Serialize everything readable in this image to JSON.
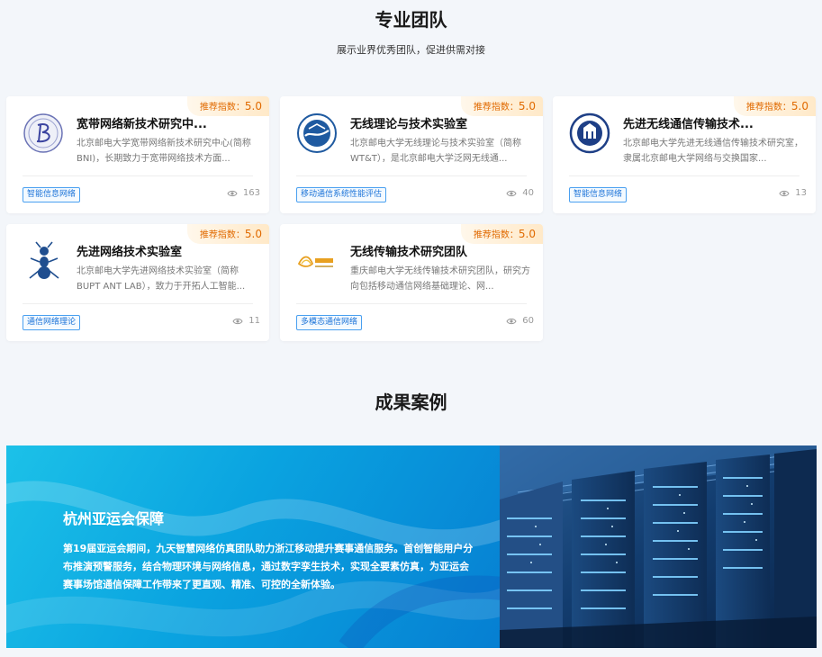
{
  "team": {
    "title": "专业团队",
    "subtitle": "展示业界优秀团队，促进供需对接",
    "score_label": "推荐指数：",
    "cards": [
      {
        "title": "宽带网络新技术研究中...",
        "desc": "北京邮电大学宽带网络新技术研究中心(简称BNI)，长期致力于宽带网络技术方面...",
        "score": "5.0",
        "tag": "智能信息网络",
        "views": "163",
        "logo": "bni-logo-icon"
      },
      {
        "title": "无线理论与技术实验室",
        "desc": "北京邮电大学无线理论与技术实验室（简称WT&T），是北京邮电大学泛网无线通...",
        "score": "5.0",
        "tag": "移动通信系统性能评估",
        "views": "40",
        "logo": "wtt-logo-icon"
      },
      {
        "title": "先进无线通信传输技术...",
        "desc": "北京邮电大学先进无线通信传输技术研究室，隶属北京邮电大学网络与交换国家...",
        "score": "5.0",
        "tag": "智能信息网络",
        "views": "13",
        "logo": "seal-logo-icon"
      },
      {
        "title": "先进网络技术实验室",
        "desc": "北京邮电大学先进网络技术实验室（简称BUPT ANT LAB），致力于开拓人工智能...",
        "score": "5.0",
        "tag": "通信网络理论",
        "views": "11",
        "logo": "ant-logo-icon"
      },
      {
        "title": "无线传输技术研究团队",
        "desc": "重庆邮电大学无线传输技术研究团队，研究方向包括移动通信网络基础理论、网...",
        "score": "5.0",
        "tag": "多模态通信网络",
        "views": "60",
        "logo": "cqupt-logo-icon"
      }
    ]
  },
  "cases": {
    "title": "成果案例",
    "item": {
      "title": "杭州亚运会保障",
      "desc": "第19届亚运会期间，九天智慧网络仿真团队助力浙江移动提升赛事通信服务。首创智能用户分布推演预警服务，结合物理环境与网络信息，通过数字孪生技术，实现全要素仿真，为亚运会赛事场馆通信保障工作带来了更直观、精准、可控的全新体验。",
      "image": "server-room-image"
    }
  },
  "colors": {
    "accent": "#1b73d8",
    "score": "#e06a00",
    "banner_start": "#1cc1e8",
    "banner_end": "#067fd2"
  },
  "icons": {
    "views": "eye-icon"
  }
}
